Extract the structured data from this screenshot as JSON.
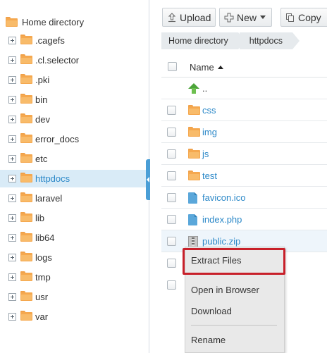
{
  "tree": {
    "root_label": "Home directory",
    "items": [
      {
        "label": ".cagefs",
        "selected": false
      },
      {
        "label": ".cl.selector",
        "selected": false
      },
      {
        "label": ".pki",
        "selected": false
      },
      {
        "label": "bin",
        "selected": false
      },
      {
        "label": "dev",
        "selected": false
      },
      {
        "label": "error_docs",
        "selected": false
      },
      {
        "label": "etc",
        "selected": false
      },
      {
        "label": "httpdocs",
        "selected": true
      },
      {
        "label": "laravel",
        "selected": false
      },
      {
        "label": "lib",
        "selected": false
      },
      {
        "label": "lib64",
        "selected": false
      },
      {
        "label": "logs",
        "selected": false
      },
      {
        "label": "tmp",
        "selected": false
      },
      {
        "label": "usr",
        "selected": false
      },
      {
        "label": "var",
        "selected": false
      }
    ]
  },
  "toolbar": {
    "upload_label": "Upload",
    "new_label": "New",
    "copy_label": "Copy"
  },
  "breadcrumb": [
    "Home directory",
    "httpdocs"
  ],
  "file_list": {
    "header_name": "Name",
    "sort": "ascending",
    "rows": [
      {
        "name": "..",
        "type": "parent"
      },
      {
        "name": "css",
        "type": "folder"
      },
      {
        "name": "img",
        "type": "folder"
      },
      {
        "name": "js",
        "type": "folder"
      },
      {
        "name": "test",
        "type": "folder"
      },
      {
        "name": "favicon.ico",
        "type": "file"
      },
      {
        "name": "index.php",
        "type": "file"
      },
      {
        "name": "public.zip",
        "type": "zip"
      }
    ]
  },
  "context_menu": {
    "items": [
      "Extract Files",
      "Open in Browser",
      "Download",
      "Rename"
    ],
    "highlighted": "Extract Files"
  },
  "colors": {
    "accent": "#2b88c8",
    "selection": "#d9ebf7",
    "highlight_border": "#c8202a",
    "folder": "#f5a84f"
  }
}
